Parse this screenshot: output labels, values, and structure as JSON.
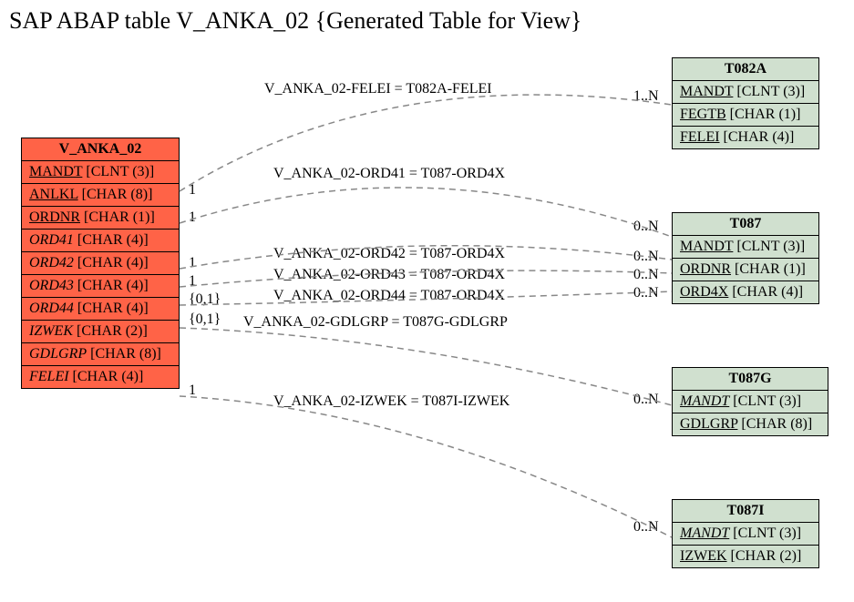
{
  "title": "SAP ABAP table V_ANKA_02 {Generated Table for View}",
  "main": {
    "name": "V_ANKA_02",
    "rows": [
      {
        "field": "MANDT",
        "type": "[CLNT (3)]",
        "style": "u"
      },
      {
        "field": "ANLKL",
        "type": "[CHAR (8)]",
        "style": "u"
      },
      {
        "field": "ORDNR",
        "type": "[CHAR (1)]",
        "style": "u"
      },
      {
        "field": "ORD41",
        "type": "[CHAR (4)]",
        "style": "i"
      },
      {
        "field": "ORD42",
        "type": "[CHAR (4)]",
        "style": "i"
      },
      {
        "field": "ORD43",
        "type": "[CHAR (4)]",
        "style": "i"
      },
      {
        "field": "ORD44",
        "type": "[CHAR (4)]",
        "style": "i"
      },
      {
        "field": "IZWEK",
        "type": "[CHAR (2)]",
        "style": "i"
      },
      {
        "field": "GDLGRP",
        "type": "[CHAR (8)]",
        "style": "i"
      },
      {
        "field": "FELEI",
        "type": "[CHAR (4)]",
        "style": "i"
      }
    ]
  },
  "t082a": {
    "name": "T082A",
    "rows": [
      {
        "field": "MANDT",
        "type": "[CLNT (3)]",
        "style": "u"
      },
      {
        "field": "FEGTB",
        "type": "[CHAR (1)]",
        "style": "u"
      },
      {
        "field": "FELEI",
        "type": "[CHAR (4)]",
        "style": "u"
      }
    ]
  },
  "t087": {
    "name": "T087",
    "rows": [
      {
        "field": "MANDT",
        "type": "[CLNT (3)]",
        "style": "u"
      },
      {
        "field": "ORDNR",
        "type": "[CHAR (1)]",
        "style": "u"
      },
      {
        "field": "ORD4X",
        "type": "[CHAR (4)]",
        "style": "u"
      }
    ]
  },
  "t087g": {
    "name": "T087G",
    "rows": [
      {
        "field": "MANDT",
        "type": "[CLNT (3)]",
        "style": "ui"
      },
      {
        "field": "GDLGRP",
        "type": "[CHAR (8)]",
        "style": "u"
      }
    ]
  },
  "t087i": {
    "name": "T087I",
    "rows": [
      {
        "field": "MANDT",
        "type": "[CLNT (3)]",
        "style": "ui"
      },
      {
        "field": "IZWEK",
        "type": "[CHAR (2)]",
        "style": "u"
      }
    ]
  },
  "edges": [
    {
      "label": "V_ANKA_02-FELEI = T082A-FELEI",
      "left_card": "1",
      "right_card": "1..N"
    },
    {
      "label": "V_ANKA_02-ORD41 = T087-ORD4X",
      "left_card": "1",
      "right_card": "0..N"
    },
    {
      "label": "V_ANKA_02-ORD42 = T087-ORD4X",
      "left_card": "1",
      "right_card": "0..N"
    },
    {
      "label": "V_ANKA_02-ORD43 = T087-ORD4X",
      "left_card": "1",
      "right_card": "0..N"
    },
    {
      "label": "V_ANKA_02-ORD44 = T087-ORD4X",
      "left_card": "{0,1}",
      "right_card": "0..N"
    },
    {
      "label": "V_ANKA_02-GDLGRP = T087G-GDLGRP",
      "left_card": "",
      "right_card": "0..N"
    },
    {
      "label": "V_ANKA_02-IZWEK = T087I-IZWEK",
      "left_card": "1",
      "right_card": "0..N"
    }
  ]
}
